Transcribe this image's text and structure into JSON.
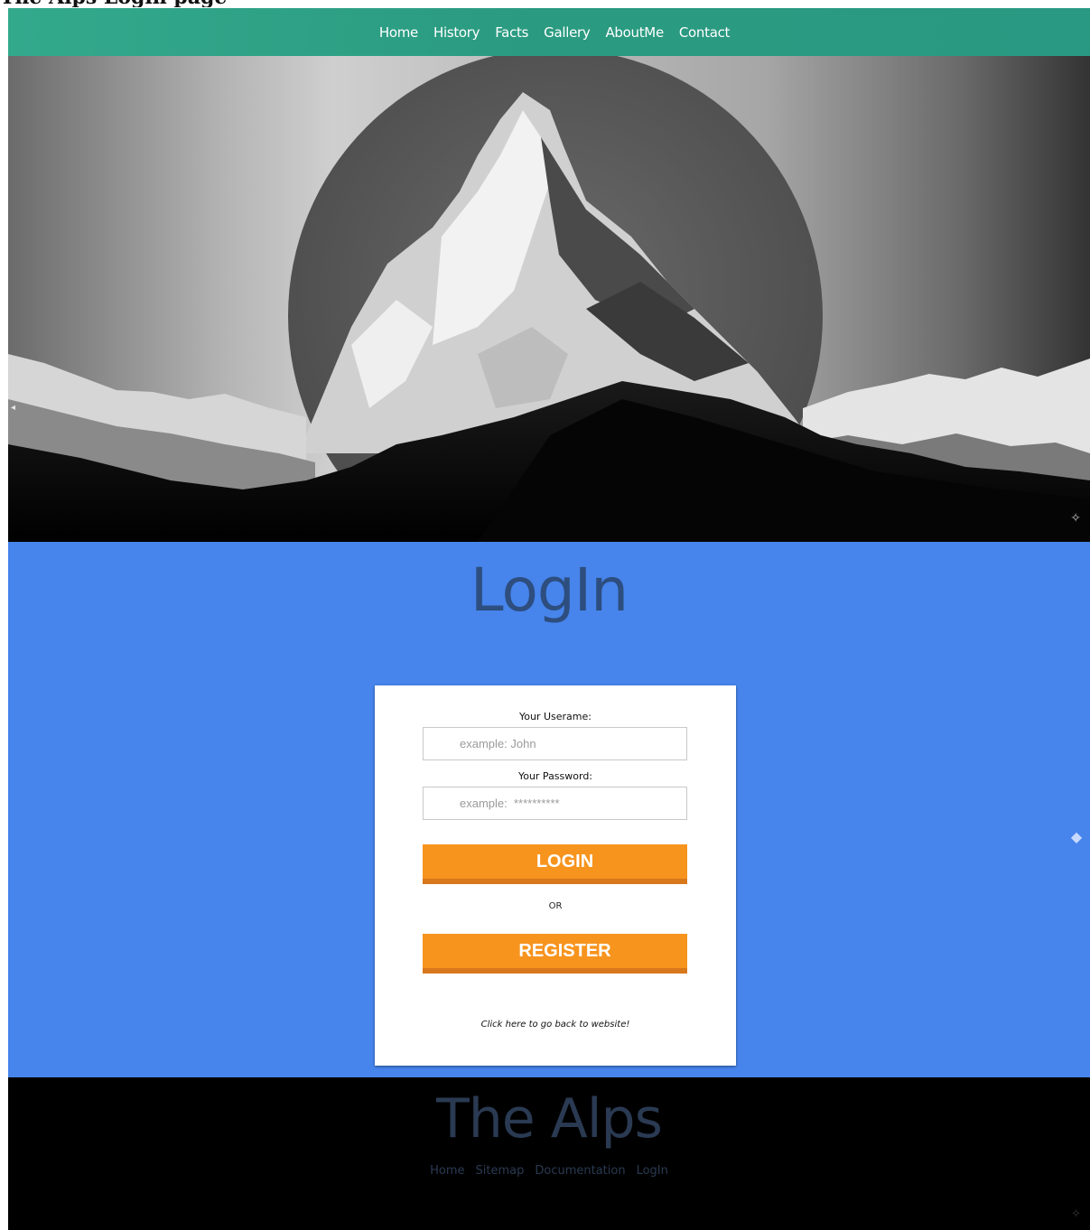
{
  "page": {
    "heading": "The Alps Login page"
  },
  "nav": {
    "items": [
      "Home",
      "History",
      "Facts",
      "Gallery",
      "AboutMe",
      "Contact"
    ]
  },
  "hero": {
    "image": "mountain-in-circle"
  },
  "login": {
    "title": "LogIn",
    "username_label": "Your Userame:",
    "username_placeholder": "example: John",
    "password_label": "Your Password:",
    "password_placeholder": "example:  **********",
    "login_button": "LOGIN",
    "or_text": "OR",
    "register_button": "REGISTER",
    "back_link": "Click here to go back to website!"
  },
  "footer": {
    "title": "The Alps",
    "links": [
      "Home",
      "Sitemap",
      "Documentation",
      "LogIn"
    ]
  },
  "colors": {
    "nav_bg": "#2fa387",
    "login_bg": "#4784ec",
    "button": "#f7941e",
    "button_shadow": "#d8781c",
    "title_text": "#2d4e7e",
    "footer_bg": "#000000"
  }
}
